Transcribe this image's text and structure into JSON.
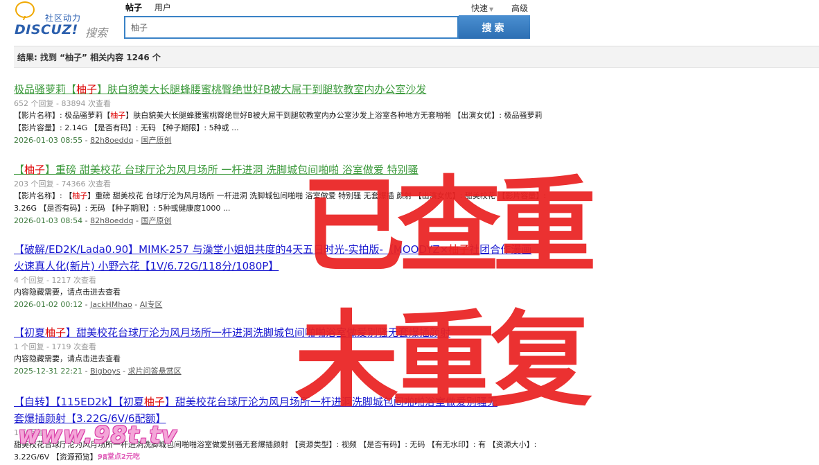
{
  "logo": {
    "cn": "社区动力",
    "en": "DISCUZ!",
    "search": "搜索"
  },
  "tabs": [
    {
      "label": "帖子"
    },
    {
      "label": "用户"
    }
  ],
  "quick": "快速",
  "advanced": "高级",
  "search": {
    "value": "柚子",
    "button": "搜索"
  },
  "result_summary": "结果: 找到 “柚子” 相关内容 1246 个",
  "results": [
    {
      "title_pre": "极品骚萝莉【",
      "title_hl": "柚子",
      "title_post": "】肤白貌美大长腿蜂腰蜜桃臀绝世好B被大屌干到腿软教室内办公室沙发",
      "title_line2": "",
      "meta": "652 个回复 - 83894 次查看",
      "desc_pre": "【影片名称】: 极品骚萝莉【",
      "desc_hl": "柚子",
      "desc_post": "】肤白貌美大长腿蜂腰蜜桃臀绝世好B被大屌干到腿软教室内办公室沙发上浴室各种地方无套啪啪 【出演女优】: 极品骚萝莉 【影片容量】: 2.14G 【是否有码】: 无码 【种子期限】: 5种或 ...",
      "date": "2026-01-03 08:55",
      "author": "82h8oeddq",
      "forum": "国产原创"
    },
    {
      "title_pre": "【",
      "title_hl": "柚子",
      "title_post": "】重磅 甜美校花 台球厅沦为风月场所 一杆进洞 洗脚城包间啪啪 浴室做爱 特别骚",
      "title_line2": "",
      "meta": "203 个回复 - 74366 次查看",
      "desc_pre": "【影片名称】: 【",
      "desc_hl": "柚子",
      "desc_post": "】重磅 甜美校花 台球厅沦为风月场所 一杆进洞 洗脚城包间啪啪 浴室做爱 特别骚 无套爆插 颜射 【出演女优】: 甜美校花 【影片容量】: 3.26G 【是否有码】: 无码 【种子期限】: 5种或健康度1000 ...",
      "date": "2026-01-03 08:54",
      "author": "82h8oeddq",
      "forum": "国产原创"
    },
    {
      "title_pre": "【破解/ED2K/Lada0.90】MIMK-257 与澡堂小姐姐共度的4天五日时光-实拍版-（MOODYZ×",
      "title_hl": "柚子",
      "title_post": "社团合作漫画",
      "title_line2": "火速真人化(新片) 小野六花【1V/6.72G/118分/1080P】",
      "meta": "4 个回复 - 1217 次查看",
      "desc_pre": "内容隐藏需要，请点击进去查看",
      "desc_hl": "",
      "desc_post": "",
      "date": "2026-01-02 00:12",
      "author": "JackHMhao",
      "forum": "AI专区"
    },
    {
      "title_pre": "【初夏",
      "title_hl": "柚子",
      "title_post": "】甜美校花台球厅沦为风月场所一杆进洞洗脚城包间啪啪浴室做爱别骚无套爆插颜射",
      "title_line2": "",
      "meta": "1 个回复 - 1719 次查看",
      "desc_pre": "内容隐藏需要，请点击进去查看",
      "desc_hl": "",
      "desc_post": "",
      "date": "2025-12-31 22:21",
      "author": "Bigboys",
      "forum": "求片问答悬赏区"
    },
    {
      "title_pre": "【自转】【115ED2k】【初夏",
      "title_hl": "柚子",
      "title_post": "】甜美校花台球厅沦为风月场所一杆进洞洗脚城包间啪啪浴室做爱别骚无",
      "title_line2": "套爆插颜射【3.22G/6V/6配额】",
      "meta": "1 个回复",
      "desc_pre": "甜美校花台球厅沦为风月场所一杆进洞洗脚城包间啪啪浴室做爱别骚无套爆插颜射 【资源类型】: 视频 【是否有码】: 无码 【有无水印】: 有 【资源大小】: 3.22G/6V 【资源预览】: ...",
      "desc_hl": "",
      "desc_post": "",
      "date": "",
      "author": "",
      "forum": ""
    }
  ],
  "stamp": {
    "line1": "已查重",
    "line2": "未重复"
  },
  "watermark": {
    "main": "www.98t.tv",
    "sub": "98堂点2元吃"
  }
}
